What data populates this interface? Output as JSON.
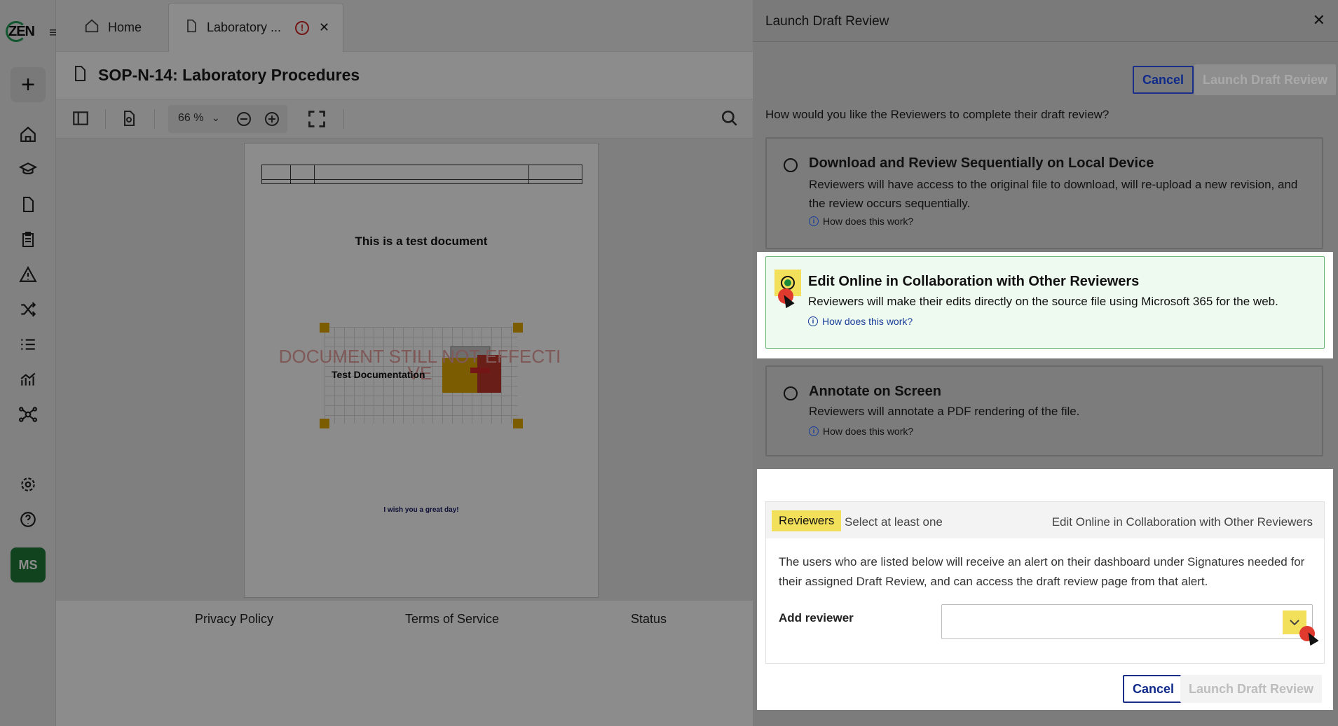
{
  "app": {
    "logo_text": "ZEN",
    "avatar_initials": "MS"
  },
  "tabs": [
    {
      "label": "Home"
    },
    {
      "label": "Laboratory ..."
    }
  ],
  "document": {
    "title": "SOP-N-14: Laboratory Procedures",
    "zoom": "66 %",
    "page_heading": "This is a test document",
    "watermark_line1": "DOCUMENT STILL NOT EFFECTI",
    "watermark_line2": "VE",
    "image_caption": "Test Documentation",
    "closing_text": "I wish you a great day!"
  },
  "footer": {
    "privacy": "Privacy Policy",
    "terms": "Terms of Service",
    "status": "Status"
  },
  "modal": {
    "title": "Launch Draft Review",
    "cancel_label": "Cancel",
    "launch_label": "Launch Draft Review",
    "question": "How would you like the Reviewers to complete their draft review?",
    "help_label": "How does this work?",
    "options": [
      {
        "title": "Download and Review Sequentially on Local Device",
        "description": "Reviewers will have access to the original file to download, will re-upload a new revision, and the review occurs sequentially.",
        "selected": false
      },
      {
        "title": "Edit Online in Collaboration with Other Reviewers",
        "description": "Reviewers will make their edits directly on the source file using Microsoft 365 for the web.",
        "selected": true
      },
      {
        "title": "Annotate on Screen",
        "description": "Reviewers will annotate a PDF rendering of the file.",
        "selected": false
      }
    ],
    "reviewers": {
      "badge": "Reviewers",
      "hint": "Select at least one",
      "mode": "Edit Online in Collaboration with Other Reviewers",
      "description": "The users who are listed below will receive an alert on their dashboard under Signatures needed for their assigned Draft Review, and can access the draft review page from that alert.",
      "add_label": "Add reviewer",
      "add_value": ""
    }
  },
  "colors": {
    "accent": "#1a2f8a",
    "brand_green": "#1f7a3a",
    "highlight": "#f3e05a",
    "selected_bg": "#eef9ef"
  }
}
